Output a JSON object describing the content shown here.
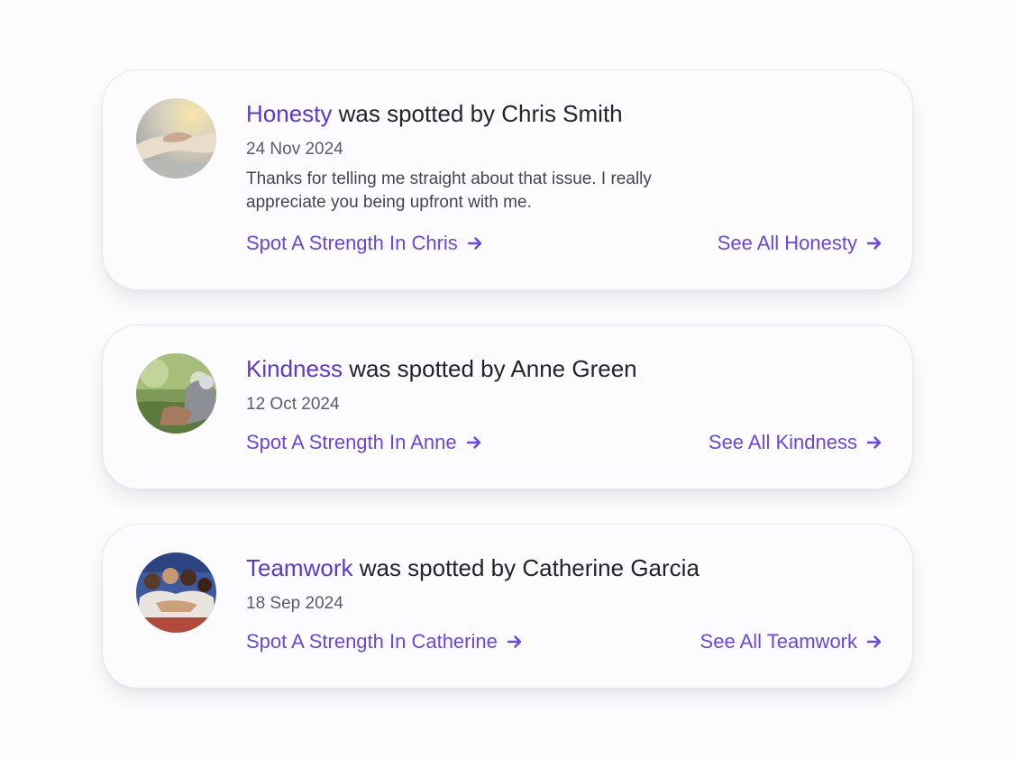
{
  "cards": [
    {
      "strength": "Honesty",
      "spotted_text": " was spotted by Chris Smith",
      "date": "24 Nov 2024",
      "message": "Thanks for telling me straight about that issue. I really appreciate you being upfront with me.",
      "spot_link": "Spot A Strength In Chris",
      "see_all_link": "See All Honesty"
    },
    {
      "strength": "Kindness",
      "spotted_text": " was spotted by Anne Green",
      "date": "12 Oct 2024",
      "spot_link": "Spot A Strength In Anne",
      "see_all_link": "See All Kindness"
    },
    {
      "strength": "Teamwork",
      "spotted_text": " was spotted by Catherine Garcia",
      "date": "18 Sep 2024",
      "spot_link": "Spot A Strength In Catherine",
      "see_all_link": "See All Teamwork"
    }
  ],
  "colors": {
    "accent": "#5b37d9",
    "link": "#6a45e8",
    "text": "#232328",
    "muted": "#5c5c64",
    "card_bg": "#fcfcff"
  },
  "icons": {
    "link_arrow": "arrow-right-icon"
  }
}
